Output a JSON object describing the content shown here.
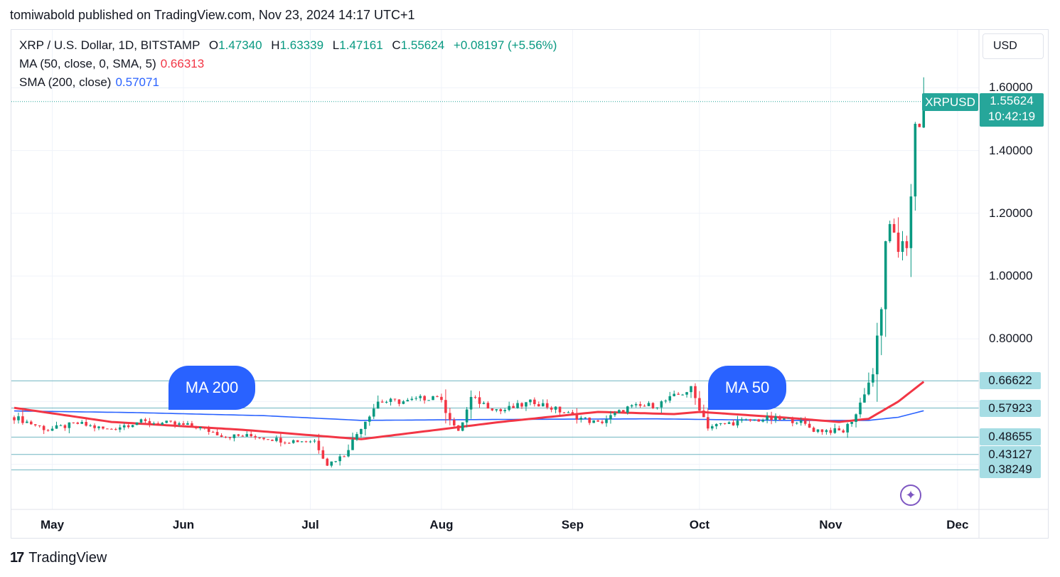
{
  "header": {
    "publisher": "tomiwabold published on TradingView.com, Nov 23, 2024 14:17 UTC+1"
  },
  "legend": {
    "symbol": "XRP / U.S. Dollar, 1D, BITSTAMP",
    "o_key": "O",
    "o_val": "1.47340",
    "h_key": "H",
    "h_val": "1.63339",
    "l_key": "L",
    "l_val": "1.47161",
    "c_key": "C",
    "c_val": "1.55624",
    "change": "+0.08197 (+5.56%)",
    "ma50_label": "MA (50, close, 0, SMA, 5)",
    "ma50_value": "0.66313",
    "sma200_label": "SMA (200, close)",
    "sma200_value": "0.57071"
  },
  "currency": "USD",
  "last_price": {
    "symbol": "XRPUSD",
    "price": "1.55624",
    "countdown": "10:42:19"
  },
  "price_tags": [
    {
      "label": "0.66622",
      "value": 0.66622
    },
    {
      "label": "0.57923",
      "value": 0.57923
    },
    {
      "label": "0.48655",
      "value": 0.48655
    },
    {
      "label": "0.43127",
      "value": 0.43127
    },
    {
      "label": "0.38249",
      "value": 0.38249
    }
  ],
  "callouts": {
    "ma200": "MA 200",
    "ma50": "MA 50"
  },
  "branding": {
    "logo_mark": "17",
    "logo_text": "TradingView"
  },
  "icons": {
    "ai": "sparkle-icon",
    "logo": "tradingview-logo-icon"
  },
  "colors": {
    "up": "#089981",
    "down": "#f23645",
    "ma50": "#f23645",
    "sma200": "#2962ff",
    "hline": "#6fb6c1",
    "last": "#26a69a"
  },
  "chart_data": {
    "type": "candlestick",
    "symbol": "XRP / U.S. Dollar",
    "interval": "1D",
    "ylim": [
      0.28,
      1.65
    ],
    "y_ticks": [
      0.8,
      1.0,
      1.2,
      1.4,
      1.6
    ],
    "y_tick_labels": [
      "0.80000",
      "1.00000",
      "1.20000",
      "1.40000",
      "1.60000"
    ],
    "x_ticks": [
      {
        "label": "May",
        "date": "2024-05-01"
      },
      {
        "label": "Jun",
        "date": "2024-06-01"
      },
      {
        "label": "Jul",
        "date": "2024-07-01"
      },
      {
        "label": "Aug",
        "date": "2024-08-01"
      },
      {
        "label": "Sep",
        "date": "2024-09-01"
      },
      {
        "label": "Oct",
        "date": "2024-10-01"
      },
      {
        "label": "Nov",
        "date": "2024-11-01"
      },
      {
        "label": "Dec",
        "date": "2024-12-01"
      }
    ],
    "x_range": [
      "2024-04-22",
      "2024-12-10"
    ],
    "last_candle": {
      "date": "2024-11-23",
      "open": 1.4734,
      "high": 1.63339,
      "low": 1.47161,
      "close": 1.55624
    },
    "close_keypoints": [
      {
        "date": "2024-04-22",
        "close": 0.55
      },
      {
        "date": "2024-04-30",
        "close": 0.51
      },
      {
        "date": "2024-05-07",
        "close": 0.53
      },
      {
        "date": "2024-05-14",
        "close": 0.51
      },
      {
        "date": "2024-05-21",
        "close": 0.535
      },
      {
        "date": "2024-05-28",
        "close": 0.53
      },
      {
        "date": "2024-06-04",
        "close": 0.52
      },
      {
        "date": "2024-06-11",
        "close": 0.49
      },
      {
        "date": "2024-06-18",
        "close": 0.49
      },
      {
        "date": "2024-06-25",
        "close": 0.475
      },
      {
        "date": "2024-07-02",
        "close": 0.475
      },
      {
        "date": "2024-07-05",
        "close": 0.4
      },
      {
        "date": "2024-07-09",
        "close": 0.43
      },
      {
        "date": "2024-07-13",
        "close": 0.52
      },
      {
        "date": "2024-07-17",
        "close": 0.6
      },
      {
        "date": "2024-07-24",
        "close": 0.6
      },
      {
        "date": "2024-07-31",
        "close": 0.62
      },
      {
        "date": "2024-08-05",
        "close": 0.5
      },
      {
        "date": "2024-08-08",
        "close": 0.61
      },
      {
        "date": "2024-08-15",
        "close": 0.57
      },
      {
        "date": "2024-08-23",
        "close": 0.6
      },
      {
        "date": "2024-08-31",
        "close": 0.56
      },
      {
        "date": "2024-09-07",
        "close": 0.53
      },
      {
        "date": "2024-09-14",
        "close": 0.58
      },
      {
        "date": "2024-09-21",
        "close": 0.59
      },
      {
        "date": "2024-09-29",
        "close": 0.64
      },
      {
        "date": "2024-10-03",
        "close": 0.52
      },
      {
        "date": "2024-10-10",
        "close": 0.535
      },
      {
        "date": "2024-10-17",
        "close": 0.545
      },
      {
        "date": "2024-10-24",
        "close": 0.54
      },
      {
        "date": "2024-10-28",
        "close": 0.51
      },
      {
        "date": "2024-11-04",
        "close": 0.505
      },
      {
        "date": "2024-11-07",
        "close": 0.56
      },
      {
        "date": "2024-11-09",
        "close": 0.63
      },
      {
        "date": "2024-11-11",
        "close": 0.69
      },
      {
        "date": "2024-11-12",
        "close": 0.8
      },
      {
        "date": "2024-11-13",
        "close": 0.89
      },
      {
        "date": "2024-11-14",
        "close": 1.12
      },
      {
        "date": "2024-11-15",
        "close": 1.15
      },
      {
        "date": "2024-11-16",
        "close": 1.12
      },
      {
        "date": "2024-11-17",
        "close": 1.08
      },
      {
        "date": "2024-11-18",
        "close": 1.12
      },
      {
        "date": "2024-11-19",
        "close": 1.1
      },
      {
        "date": "2024-11-20",
        "close": 1.24
      },
      {
        "date": "2024-11-21",
        "close": 1.47
      },
      {
        "date": "2024-11-22",
        "close": 1.47
      },
      {
        "date": "2024-11-23",
        "close": 1.55624
      }
    ],
    "ma50_keypoints": [
      {
        "date": "2024-04-22",
        "value": 0.58
      },
      {
        "date": "2024-05-15",
        "value": 0.535
      },
      {
        "date": "2024-06-15",
        "value": 0.51
      },
      {
        "date": "2024-07-13",
        "value": 0.48
      },
      {
        "date": "2024-08-15",
        "value": 0.535
      },
      {
        "date": "2024-09-07",
        "value": 0.567
      },
      {
        "date": "2024-09-25",
        "value": 0.56
      },
      {
        "date": "2024-10-01",
        "value": 0.567
      },
      {
        "date": "2024-10-20",
        "value": 0.55
      },
      {
        "date": "2024-11-03",
        "value": 0.535
      },
      {
        "date": "2024-11-10",
        "value": 0.545
      },
      {
        "date": "2024-11-17",
        "value": 0.6
      },
      {
        "date": "2024-11-23",
        "value": 0.66313
      }
    ],
    "sma200_keypoints": [
      {
        "date": "2024-04-22",
        "value": 0.57
      },
      {
        "date": "2024-05-20",
        "value": 0.565
      },
      {
        "date": "2024-06-20",
        "value": 0.555
      },
      {
        "date": "2024-07-13",
        "value": 0.54
      },
      {
        "date": "2024-08-15",
        "value": 0.543
      },
      {
        "date": "2024-09-20",
        "value": 0.545
      },
      {
        "date": "2024-10-20",
        "value": 0.54
      },
      {
        "date": "2024-11-10",
        "value": 0.54
      },
      {
        "date": "2024-11-17",
        "value": 0.55
      },
      {
        "date": "2024-11-23",
        "value": 0.57071
      }
    ],
    "horizontal_lines": [
      0.66622,
      0.57923,
      0.48655,
      0.43127,
      0.38249
    ]
  }
}
